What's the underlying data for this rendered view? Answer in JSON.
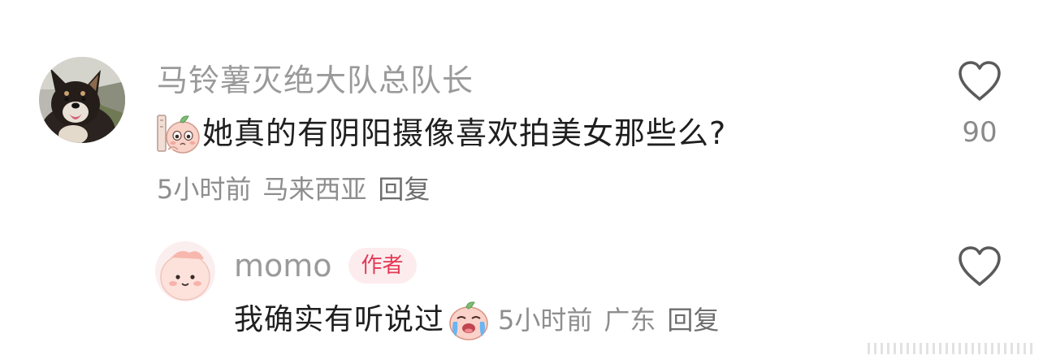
{
  "comment": {
    "username": "马铃薯灭绝大队总队长",
    "avatar_icon": "shiba-dog-avatar",
    "sticker_icon": "peeking-peach-sticker",
    "text": "她真的有阴阳摄像喜欢拍美女那些么?",
    "time": "5小时前",
    "location": "马来西亚",
    "reply_label": "回复",
    "like_icon": "heart-outline-icon",
    "like_count": "90"
  },
  "reply": {
    "username": "momo",
    "avatar_icon": "pink-peach-avatar",
    "badge": "作者",
    "text": "我确实有听说过",
    "sticker_icon": "crying-peach-sticker",
    "time": "5小时前",
    "location": "广东",
    "reply_label": "回复",
    "like_icon": "heart-outline-icon"
  },
  "colors": {
    "username": "#9a9a9a",
    "text": "#1f1f1f",
    "meta": "#8e8e8e",
    "badge_bg": "#fdecee",
    "badge_text": "#e33a55"
  }
}
